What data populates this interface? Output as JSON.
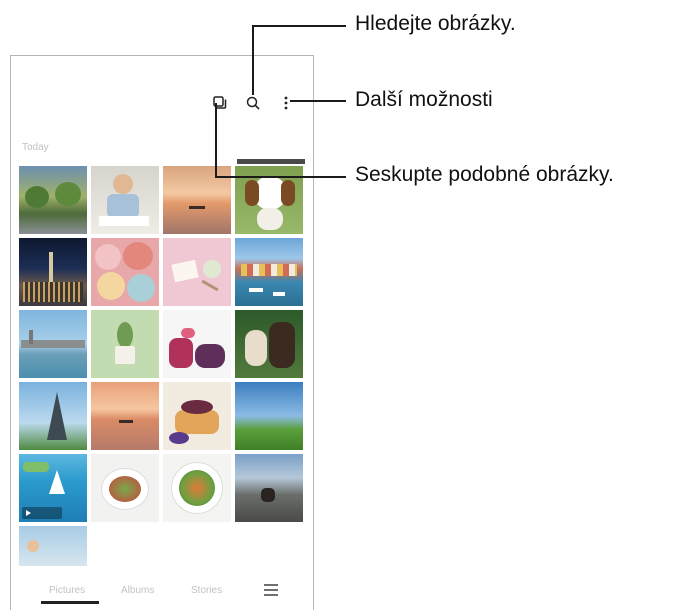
{
  "phone": {
    "section_label": "Today",
    "toolbar": {
      "icons": [
        "group-similar-icon",
        "search-icon",
        "more-options-icon"
      ]
    },
    "bottom_nav": {
      "tabs": [
        {
          "label": "Pictures",
          "selected": true
        },
        {
          "label": "Albums",
          "selected": false
        },
        {
          "label": "Stories",
          "selected": false
        }
      ],
      "menu_icon": "menu-icon"
    }
  },
  "callouts": {
    "search": "Hledejte obrázky.",
    "more_options": "Další možnosti",
    "group_similar": "Seskupte podobné obrázky."
  },
  "thumbnails": [
    {
      "name": "photo-street-trees"
    },
    {
      "name": "photo-child-drawing"
    },
    {
      "name": "photo-sunset-boat"
    },
    {
      "name": "photo-beagle-dog"
    },
    {
      "name": "photo-city-night"
    },
    {
      "name": "photo-macarons"
    },
    {
      "name": "photo-pink-table"
    },
    {
      "name": "photo-harbor-boats"
    },
    {
      "name": "photo-river-city"
    },
    {
      "name": "photo-green-plant"
    },
    {
      "name": "photo-berry-macarons"
    },
    {
      "name": "photo-kitten-puppy"
    },
    {
      "name": "photo-eiffel-tower"
    },
    {
      "name": "photo-sea-sunset"
    },
    {
      "name": "photo-pancakes"
    },
    {
      "name": "photo-green-field"
    },
    {
      "name": "video-sailboat"
    },
    {
      "name": "photo-salad-table"
    },
    {
      "name": "photo-salad-bowl"
    },
    {
      "name": "photo-road-dog"
    },
    {
      "name": "photo-beach-person"
    }
  ]
}
